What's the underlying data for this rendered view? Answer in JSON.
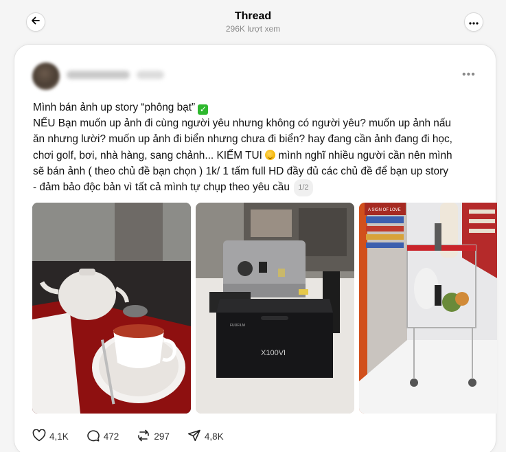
{
  "header": {
    "title": "Thread",
    "views": "296K lượt xem",
    "back_icon": "arrow-left-icon",
    "more_icon": "more-horizontal-icon"
  },
  "post": {
    "lines": [
      "Mình bán ảnh up story “phông bạt”",
      "NẾU Bạn muốn up ảnh đi cùng người yêu nhưng không có người yêu? muốn up ảnh nấu",
      "ăn nhưng lười? muốn up ảnh đi biển nhưng chưa đi biển? hay đang cần ảnh đang đi học,",
      "chơi golf, bơi, nhà hàng, sang chảnh... KIẾM TUI",
      "mình nghĩ nhiều người cần nên mình",
      "sẽ bán ảnh ( theo chủ đề bạn chọn ) 1k/ 1 tấm full HD đầy đủ các chủ đề để bạn up story",
      "- đảm bảo độc bản vì tất cả mình tự chụp theo yêu cầu"
    ],
    "page_indicator": "1/2",
    "check_icon": "✓",
    "photo_text": {
      "box_model": "X100VI",
      "box_brand": "FUJIFILM",
      "store_sign": "A SIGN OF LOVE"
    }
  },
  "actions": {
    "likes": "4,1K",
    "replies": "472",
    "reposts": "297",
    "shares": "4,8K"
  },
  "colors": {
    "background": "#f5f5f5",
    "card": "#ffffff",
    "muted": "#8a8a8a"
  }
}
